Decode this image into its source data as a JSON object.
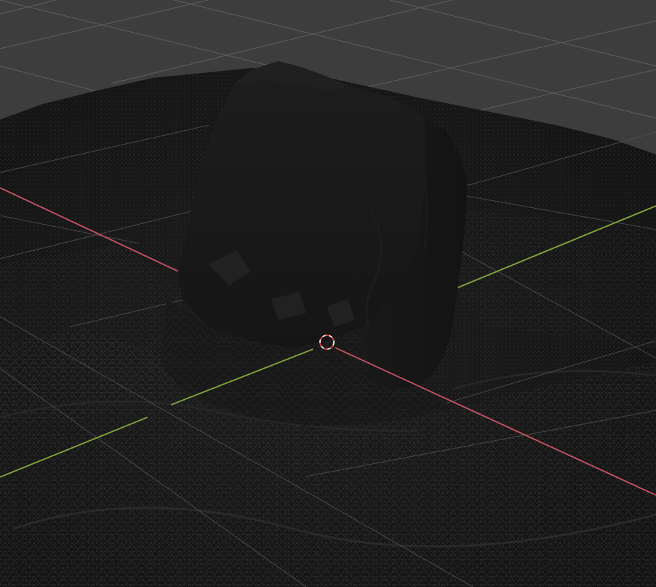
{
  "viewport": {
    "background_color": "#3d3d3d",
    "grid_color": "#5a5a5a",
    "mesh_color": "#161616",
    "wire_color": "#3a3a3a",
    "x_axis_color": "#c0505f",
    "y_axis_color": "#7ea23a",
    "cursor_icon": "3d-cursor-icon",
    "cursor_colors": [
      "#e2e2e2",
      "#d34040"
    ]
  }
}
